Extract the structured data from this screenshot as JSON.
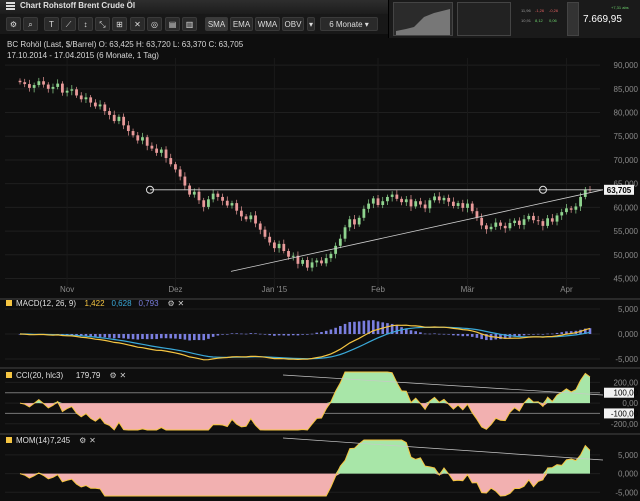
{
  "window": {
    "title": "Chart Rohstoff Brent Crude Öl"
  },
  "toolbar": {
    "indicators": [
      "SMA",
      "EMA",
      "WMA",
      "OBV"
    ],
    "period": "6 Monate"
  },
  "side_panel": {
    "price": "7.669,95",
    "small_values": [
      "11,96",
      "-1,26",
      "-0,26",
      "10,91",
      "8,12",
      "0,06"
    ],
    "change": "+7,31 abs"
  },
  "info": {
    "instrument_line": "BC Rohöl (Last, $/Barrel)  O: 63,425  H: 63,720  L: 63,370  C: 63,705",
    "range_line": "17.10.2014 - 17.04.2015 (6 Monate, 1 Tag)"
  },
  "colors": {
    "up": "#8fd48f",
    "down": "#e89a9a",
    "macd": "#f5c542",
    "signal": "#3aa9d9",
    "histogram": "#7b7fe0",
    "cci_fill_pos": "#a8e6a8",
    "cci_fill_neg": "#f2b0b0"
  },
  "chart_data": [
    {
      "type": "candlestick",
      "title": "BC Rohöl (Last, $/Barrel)",
      "x_tick_labels": [
        "Nov",
        "Dez",
        "Jan '15",
        "Feb",
        "Mär",
        "Apr"
      ],
      "y_ticks": [
        45000,
        50000,
        55000,
        60000,
        65000,
        70000,
        75000,
        80000,
        85000,
        90000
      ],
      "y_tick_labels": [
        "45,000",
        "50,000",
        "55,000",
        "60,000",
        "65,000",
        "70,000",
        "75,000",
        "80,000",
        "85,000",
        "90,000"
      ],
      "ylim": [
        43000,
        91500
      ],
      "last_value_label": "63,705",
      "last_value": 63705,
      "resistance_level": 63705,
      "close": [
        86400,
        86000,
        85200,
        85800,
        86600,
        85900,
        85000,
        85400,
        86100,
        84200,
        84600,
        84900,
        83600,
        82800,
        83200,
        82100,
        81300,
        81700,
        80300,
        79500,
        78200,
        79100,
        77300,
        76100,
        75200,
        74100,
        74800,
        73000,
        72400,
        71500,
        72200,
        70400,
        69100,
        68000,
        66500,
        64600,
        62700,
        63300,
        61500,
        60100,
        61700,
        62900,
        62200,
        61400,
        60400,
        60900,
        59300,
        58100,
        57500,
        58300,
        56600,
        55300,
        53800,
        52600,
        51400,
        52300,
        50800,
        49600,
        49800,
        48100,
        48900,
        47300,
        48400,
        48800,
        48200,
        49300,
        50200,
        51900,
        53400,
        55800,
        57500,
        56400,
        57800,
        59700,
        60800,
        61900,
        60500,
        61300,
        62200,
        62700,
        61800,
        61100,
        61700,
        60200,
        61300,
        60600,
        59800,
        61500,
        62300,
        61500,
        62000,
        61200,
        60300,
        60900,
        59900,
        60800,
        59200,
        57800,
        56200,
        55400,
        55900,
        56800,
        56100,
        55600,
        56700,
        57200,
        56300,
        57500,
        58200,
        57300,
        57100,
        56100,
        57700,
        57000,
        58300,
        59000,
        59800,
        59500,
        60200,
        62200,
        63800,
        63705
      ],
      "trendline_from": {
        "x_label": "Jan '15",
        "value": 46500
      },
      "trendline_to": {
        "x_label": "Apr",
        "value": 63705
      }
    },
    {
      "type": "line",
      "title": "MACD(12, 26, 9)",
      "values_label": [
        "1,422",
        "0,628",
        "0,793"
      ],
      "y_tick_labels": [
        "5,000",
        "0,000",
        "-5,000"
      ],
      "ylim": [
        -6000,
        6000
      ],
      "series": [
        {
          "name": "MACD",
          "color": "#f5c542"
        },
        {
          "name": "Signal",
          "color": "#3aa9d9"
        },
        {
          "name": "Histogram",
          "color": "#7b7fe0"
        }
      ]
    },
    {
      "type": "area",
      "title": "CCI(20, hlc3)",
      "current_value": "179,79",
      "y_tick_labels": [
        "200,00",
        "100,00",
        "0,00",
        "-100,00",
        "-200,00"
      ],
      "ylim": [
        -260,
        300
      ]
    },
    {
      "type": "area",
      "title": "MOM(14)",
      "current_value": "7,245",
      "y_tick_labels": [
        "5,000",
        "0,000",
        "-5,000"
      ],
      "ylim": [
        -6000,
        9000
      ]
    }
  ]
}
